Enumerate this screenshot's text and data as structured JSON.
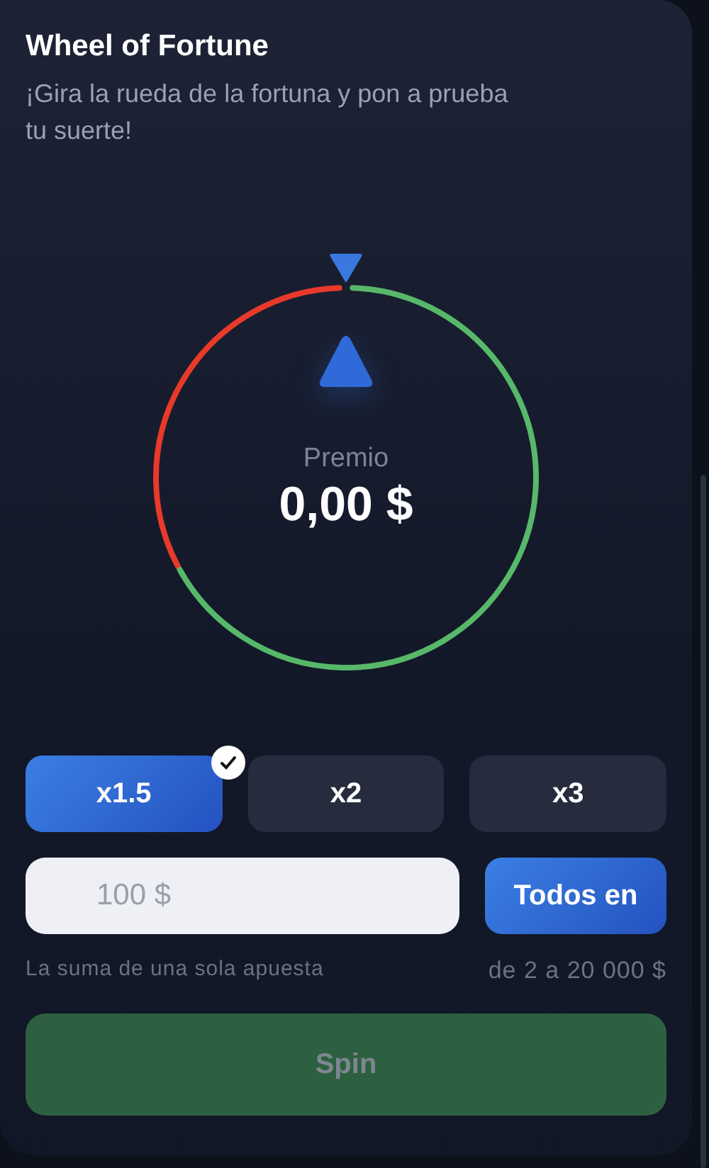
{
  "title": "Wheel of Fortune",
  "subtitle": "¡Gira la rueda de la fortuna y pon a prueba tu suerte!",
  "prize": {
    "label": "Premio",
    "value": "0,00 $"
  },
  "multipliers": [
    {
      "label": "x1.5",
      "selected": true
    },
    {
      "label": "x2",
      "selected": false
    },
    {
      "label": "x3",
      "selected": false
    }
  ],
  "bet": {
    "placeholder": "100 $",
    "button": "Todos en"
  },
  "hint": {
    "left": "La suma de una sola apuesta",
    "right": "de 2 a 20 000 $"
  },
  "spin": {
    "label": "Spin",
    "disabled": true
  }
}
